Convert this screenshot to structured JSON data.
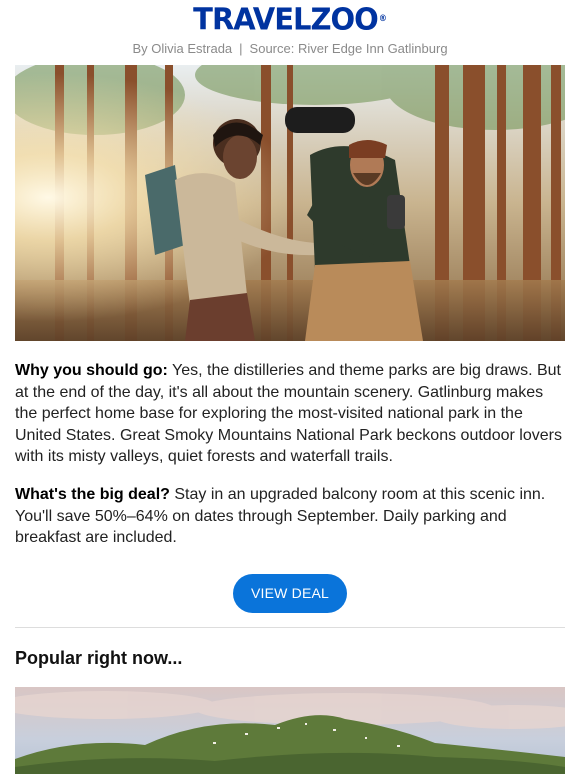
{
  "header": {
    "brand": "TRAVELZOO",
    "brand_mark": "®",
    "byline_author": "By Olivia Estrada",
    "byline_separator": "|",
    "byline_source": "Source: River Edge Inn Gatlinburg"
  },
  "article": {
    "why_label": "Why you should go:",
    "why_text": " Yes, the distilleries and theme parks are big draws. But at the end of the day, it's all about the mountain scenery. Gatlinburg makes the perfect home base for exploring the most-visited national park in the United States. Great Smoky Mountains National Park beckons outdoor lovers with its misty valleys, quiet forests and waterfall trails.",
    "deal_label": "What's the big deal?",
    "deal_text": " Stay in an upgraded balcony room at this scenic inn. You'll save 50%–64% on dates through September. Daily parking and breakfast are included.",
    "cta_label": "VIEW DEAL"
  },
  "popular": {
    "title": "Popular right now..."
  },
  "colors": {
    "brand_blue": "#0033a0",
    "cta_blue": "#0a74da",
    "byline_gray": "#8a8a8a"
  }
}
